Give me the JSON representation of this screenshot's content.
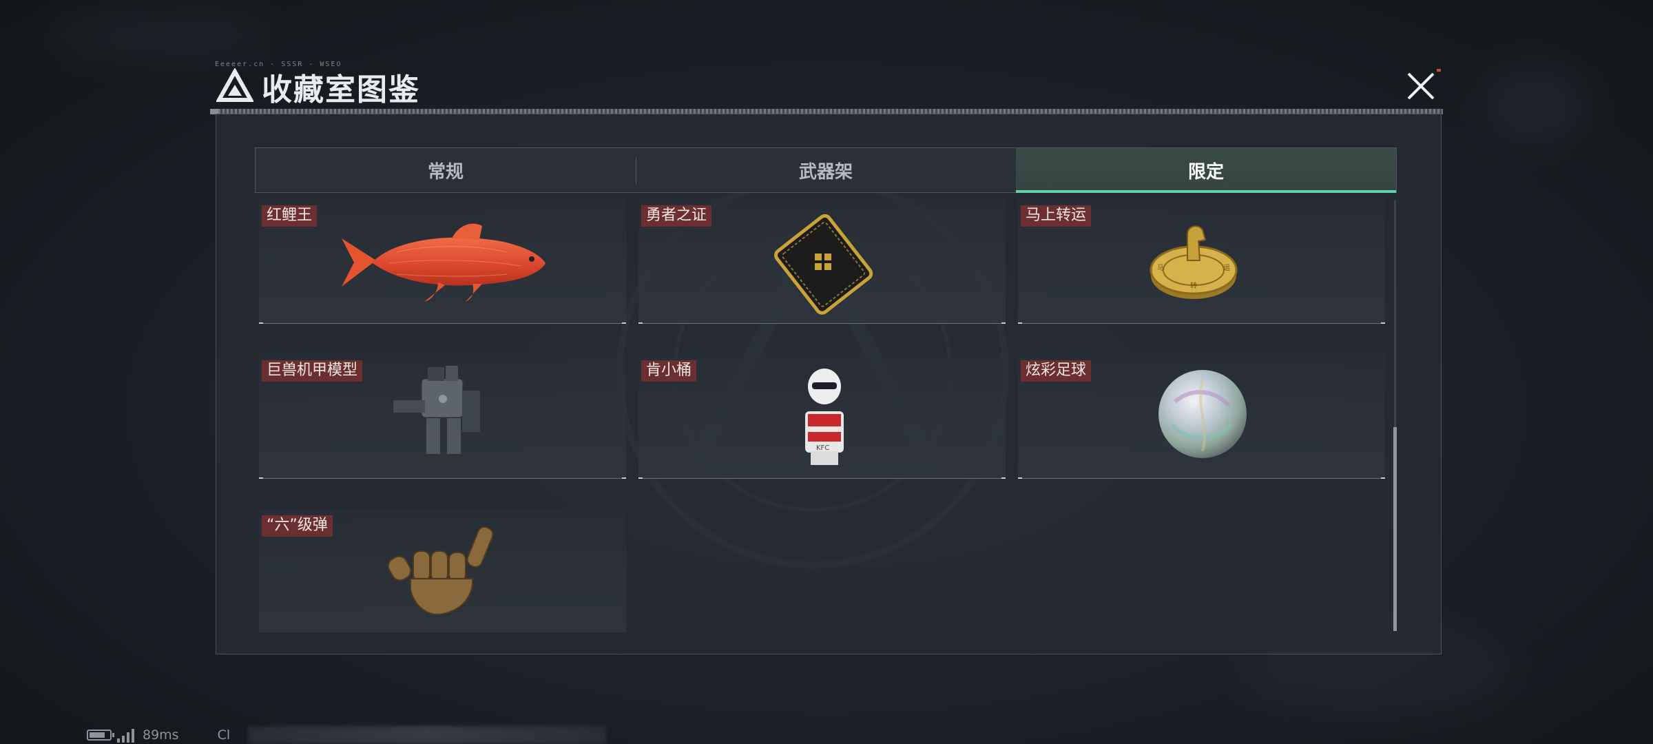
{
  "header": {
    "title": "收藏室图鉴",
    "tiny_code": "Eeeeer.cn  -  SSSR  -  WSEO"
  },
  "tabs": [
    {
      "label": "常规",
      "active": false
    },
    {
      "label": "武器架",
      "active": false
    },
    {
      "label": "限定",
      "active": true
    }
  ],
  "items": [
    {
      "name": "红鲤王",
      "icon": "red-carp-icon"
    },
    {
      "name": "勇者之证",
      "icon": "gold-card-icon"
    },
    {
      "name": "马上转运",
      "icon": "gold-horse-dial-icon"
    },
    {
      "name": "巨兽机甲模型",
      "icon": "mech-model-icon"
    },
    {
      "name": "肯小桶",
      "icon": "colonel-bucket-figure-icon"
    },
    {
      "name": "炫彩足球",
      "icon": "iridescent-ball-icon"
    },
    {
      "name": "“六”级弹",
      "icon": "bronze-hand-icon"
    }
  ],
  "status": {
    "ping": "89ms",
    "extra": "Cl"
  },
  "colors": {
    "accent": "#5fd2a8",
    "label_bg": "#6b2f31",
    "close_accent": "#c24a3a"
  }
}
